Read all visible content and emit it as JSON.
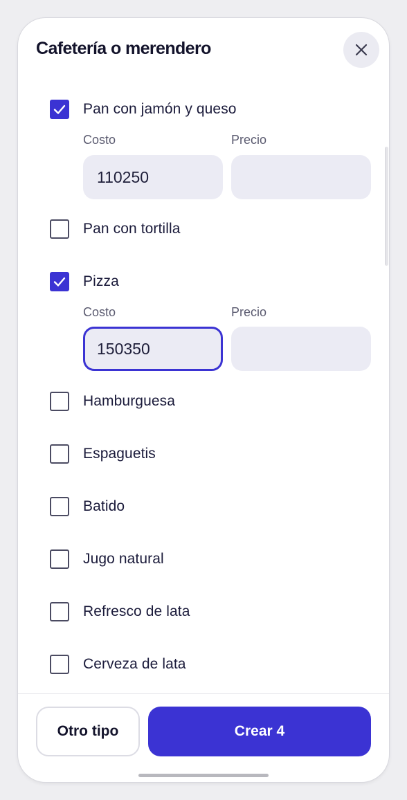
{
  "header": {
    "title": "Cafetería o merendero"
  },
  "fields": {
    "cost_label": "Costo",
    "price_label": "Precio"
  },
  "items": [
    {
      "label": "Pan con jamón y queso",
      "checked": true,
      "cost": "110250",
      "price": ""
    },
    {
      "label": "Pan con tortilla",
      "checked": false
    },
    {
      "label": "Pizza",
      "checked": true,
      "cost": "150350",
      "price": ""
    },
    {
      "label": "Hamburguesa",
      "checked": false
    },
    {
      "label": "Espaguetis",
      "checked": false
    },
    {
      "label": "Batido",
      "checked": false
    },
    {
      "label": "Jugo natural",
      "checked": false
    },
    {
      "label": "Refresco de lata",
      "checked": false
    },
    {
      "label": "Cerveza de lata",
      "checked": false
    }
  ],
  "footer": {
    "other_label": "Otro tipo",
    "create_label": "Crear 4"
  },
  "colors": {
    "accent": "#3b33d3",
    "field_bg": "#ebebf4"
  },
  "icons": {
    "close": "close-icon",
    "check": "checkmark-icon"
  }
}
